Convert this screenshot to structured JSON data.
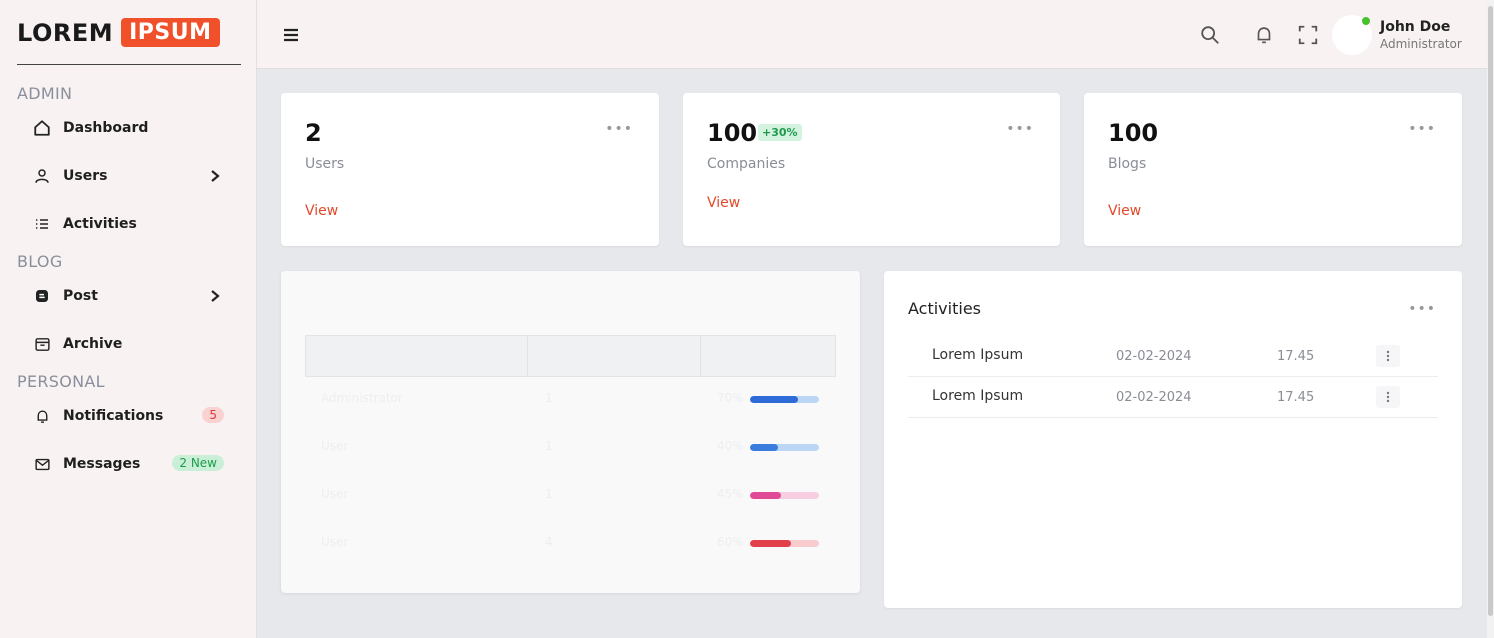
{
  "logo": {
    "word1": "LOREM",
    "word2": "IPSUM"
  },
  "sidebar": {
    "sections": [
      "ADMIN",
      "BLOG",
      "PERSONAL"
    ],
    "items": [
      {
        "label": "Dashboard",
        "icon": "home-icon"
      },
      {
        "label": "Users",
        "icon": "user-icon"
      },
      {
        "label": "Activities",
        "icon": "list-icon"
      },
      {
        "label": "Post",
        "icon": "document-icon"
      },
      {
        "label": "Archive",
        "icon": "archive-icon"
      },
      {
        "label": "Notifications",
        "icon": "bell-icon",
        "badge": "5"
      },
      {
        "label": "Messages",
        "icon": "mail-icon",
        "badge": "2 New"
      }
    ]
  },
  "header": {
    "user_name": "John Doe",
    "user_role": "Administrator"
  },
  "stats": [
    {
      "value": "2",
      "label": "Users",
      "link": "View"
    },
    {
      "value": "100",
      "label": "Companies",
      "link": "View",
      "change": "+30%"
    },
    {
      "value": "100",
      "label": "Blogs",
      "link": "View"
    }
  ],
  "table": {
    "rows": [
      {
        "name": "Administrator",
        "count": "1",
        "pct": "70%",
        "fill": 0.7,
        "color": "#2f6bd8",
        "track": "#bcd6f5"
      },
      {
        "name": "User",
        "count": "1",
        "pct": "40%",
        "fill": 0.4,
        "color": "#3b7ddd",
        "track": "#bcd6f5"
      },
      {
        "name": "User",
        "count": "1",
        "pct": "45%",
        "fill": 0.45,
        "color": "#e04a96",
        "track": "#f8cfe2"
      },
      {
        "name": "User",
        "count": "4",
        "pct": "60%",
        "fill": 0.6,
        "color": "#e2404b",
        "track": "#f8cbcf"
      }
    ]
  },
  "activities": {
    "title": "Activities",
    "rows": [
      {
        "name": "Lorem Ipsum",
        "date": "02-02-2024",
        "time": "17.45"
      },
      {
        "name": "Lorem Ipsum",
        "date": "02-02-2024",
        "time": "17.45"
      }
    ]
  },
  "colors": {
    "accent": "#f0512a",
    "link": "#e2492a",
    "sidebar_bg": "#f8f3f2",
    "page_bg": "#e7e8ec"
  }
}
